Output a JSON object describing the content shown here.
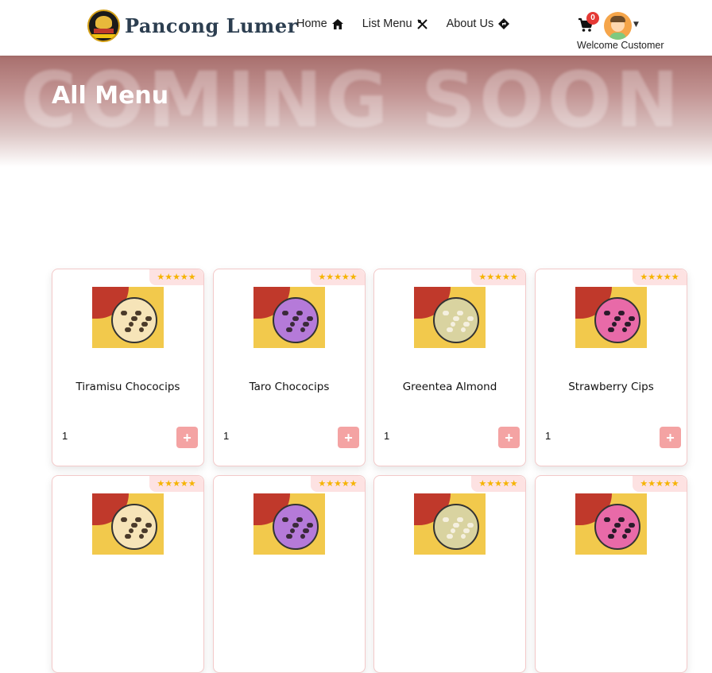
{
  "navbar": {
    "brand": "Pancong Lumer",
    "links": [
      {
        "label": "Home",
        "icon": "home-icon"
      },
      {
        "label": "List Menu",
        "icon": "utensils-icon"
      },
      {
        "label": "About Us",
        "icon": "directions-icon"
      }
    ],
    "cart_count": "0",
    "welcome": "Welcome Customer"
  },
  "hero": {
    "bg_text": "COMING SOON",
    "title": "All Menu"
  },
  "menu": {
    "rating_stars": "★★★★★",
    "items": [
      {
        "name": "Tiramisu Chococips",
        "qty": "1",
        "topping": "#4a3a2a",
        "plate": "#f6e4b8"
      },
      {
        "name": "Taro Chococips",
        "qty": "1",
        "topping": "#3a2a3a",
        "plate": "#b57ad9"
      },
      {
        "name": "Greentea Almond",
        "qty": "1",
        "topping": "#f5f0e0",
        "plate": "#d9d3a0"
      },
      {
        "name": "Strawberry Cips",
        "qty": "1",
        "topping": "#2a1a2a",
        "plate": "#e86aa8"
      }
    ],
    "add_label": "+"
  },
  "colors": {
    "accent": "#f4a3a3",
    "badge": "#e53935",
    "brand_text": "#2c3e50"
  }
}
